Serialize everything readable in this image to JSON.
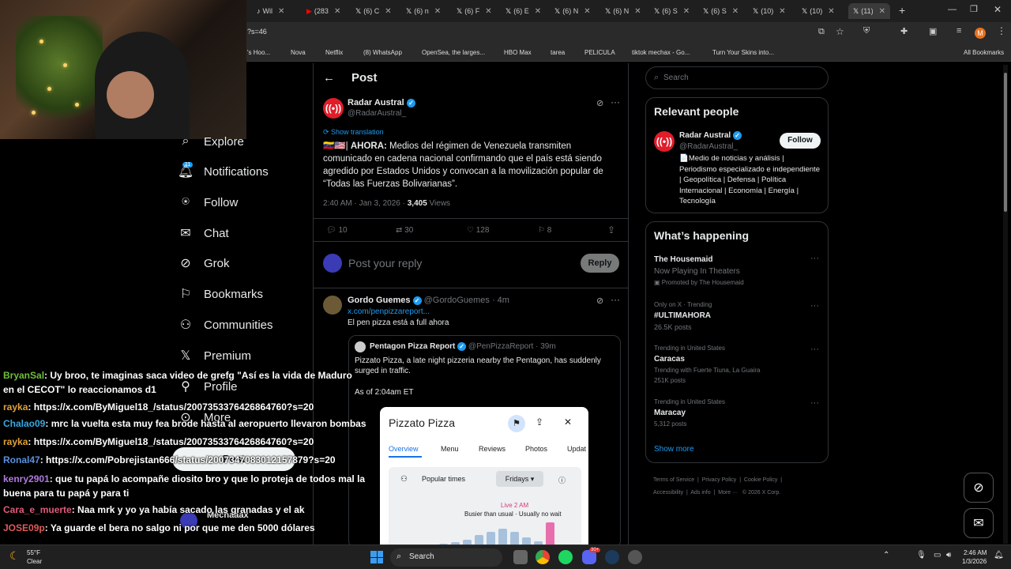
{
  "browser": {
    "tabs": [
      "Wil",
      "(283",
      "(6) C",
      "(6) n",
      "(6) F",
      "(6) E",
      "(6) N",
      "(6) N",
      "(6) S",
      "(6) S",
      "(10)",
      "(10)",
      "(11)"
    ],
    "url": "?s=46",
    "bookmarks": [
      "'s Hoo...",
      "Nova",
      "Netflix",
      "(8) WhatsApp",
      "OpenSea, the larges...",
      "HBO Max",
      "tarea",
      "PELICULA",
      "tiktok mechax - Go...",
      "Turn Your Skins into..."
    ],
    "all_bookmarks": "All Bookmarks",
    "profile_initial": "M"
  },
  "nav": {
    "items": [
      "Explore",
      "Notifications",
      "Follow",
      "Chat",
      "Grok",
      "Bookmarks",
      "Communities",
      "Premium",
      "Profile",
      "More"
    ],
    "notification_count": "11",
    "post_button": "Post",
    "account_name": "Mechaaax"
  },
  "post": {
    "header": "Post",
    "author": "Radar Austral",
    "handle": "@RadarAustral_",
    "show_translation": "Show translation",
    "text_bold": "AHORA:",
    "text_flags": "🇻🇪🇺🇸|",
    "text": "Medios del régimen de Venezuela transmiten comunicado en cadena nacional confirmando que el país está siendo agredido por Estados Unidos y convocan a la movilización popular de “Todas las Fuerzas Bolivarianas”.",
    "timestamp": "2:40 AM · Jan 3, 2026 · ",
    "views_count": "3,405",
    "views_label": " Views",
    "stats": {
      "replies": "10",
      "reposts": "30",
      "likes": "128",
      "bookmarks": "8"
    },
    "reply_placeholder": "Post your reply",
    "reply_button": "Reply"
  },
  "reply": {
    "author": "Gordo Guemes",
    "handle": "@GordoGuemes · 4m",
    "link": "x.com/penpizzareport...",
    "text": "El pen pizza está a full ahora",
    "quote": {
      "author": "Pentagon Pizza Report",
      "handle": "@PenPizzaReport · 39m",
      "text": "Pizzato Pizza, a late night pizzeria nearby the Pentagon, has suddenly surged in traffic.",
      "time_note": "As of 2:04am ET",
      "card": {
        "title": "Pizzato Pizza",
        "tabs": [
          "Overview",
          "Menu",
          "Reviews",
          "Photos",
          "Updat"
        ],
        "popular_times": "Popular times",
        "day": "Fridays",
        "live": "Live 2 AM",
        "busy": "Busier than usual · Usually no wait",
        "histogram": [
          0.05,
          0.1,
          0.15,
          0.25,
          0.45,
          0.55,
          0.7,
          0.55,
          0.35,
          0.2,
          0.95
        ]
      }
    }
  },
  "search": {
    "placeholder": "Search"
  },
  "relevant": {
    "title": "Relevant people",
    "name": "Radar Austral",
    "handle": "@RadarAustral_",
    "follow": "Follow",
    "bio": "📄Medio de noticias y análisis | Periodismo especializado e independiente | Geopolítica | Defensa | Política Internacional | Economía | Energía | Tecnología"
  },
  "trends": {
    "title": "What’s happening",
    "items": [
      {
        "context": "",
        "name": "The Housemaid",
        "sub": "Now Playing In Theaters",
        "meta": "Promoted by The Housemaid"
      },
      {
        "context": "Only on X · Trending",
        "name": "#ULTIMAHORA",
        "sub": "",
        "meta": "26.5K posts"
      },
      {
        "context": "Trending in United States",
        "name": "Caracas",
        "sub": "Trending with Fuerte Tiuna, La Guaira",
        "meta": "251K posts"
      },
      {
        "context": "Trending in United States",
        "name": "Maracay",
        "sub": "",
        "meta": "5,312 posts"
      }
    ],
    "show_more": "Show more"
  },
  "footer": {
    "line1": [
      "Terms of Service",
      "Privacy Policy",
      "Cookie Policy"
    ],
    "line2": [
      "Accessibility",
      "Ads info",
      "More ···",
      "© 2026 X Corp."
    ]
  },
  "chat": [
    {
      "user": "BryanSal",
      "color": "#6fbf3a",
      "msg": ": Uy broo, te imaginas saca video de grefg \"Así es la vida de Maduro",
      "msg2": "en el CECOT\" lo reaccionamos d1"
    },
    {
      "user": "rayka",
      "color": "#e0a13a",
      "msg": ": https://x.com/ByMiguel18_/status/2007353376426864760?s=20"
    },
    {
      "user": "Chalao09",
      "color": "#3aa7e0",
      "msg": ": mrc la vuelta esta muy fea brode hasta al aeropuerto llevaron bombas"
    },
    {
      "user": "rayka",
      "color": "#e0a13a",
      "msg": ": https://x.com/ByMiguel18_/status/2007353376426864760?s=20"
    },
    {
      "user": "Ronal47",
      "color": "#5a8fe0",
      "msg": ": https://x.com/Pobrejistan666/status/2007347083012157879?s=20"
    },
    {
      "user": "kenry2901",
      "color": "#b07be0",
      "msg": ": que tu papá lo acompañe diosito bro y que lo proteja de todos mal la",
      "msg2": "buena para tu papá y para ti"
    },
    {
      "user": "Cara_e_muerte",
      "color": "#e05a7a",
      "msg": ": Naa mrk y yo ya había sacado las granadas y el ak"
    },
    {
      "user": "JOSE09p",
      "color": "#e05a5a",
      "msg": ": Ya guarde el bera no salgo ni por que me den 5000 dólares"
    }
  ],
  "taskbar": {
    "weather_temp": "55°F",
    "weather_cond": "Clear",
    "search": "Search",
    "time": "2:46 AM",
    "date": "1/3/2026",
    "discord_badge": "30+"
  }
}
